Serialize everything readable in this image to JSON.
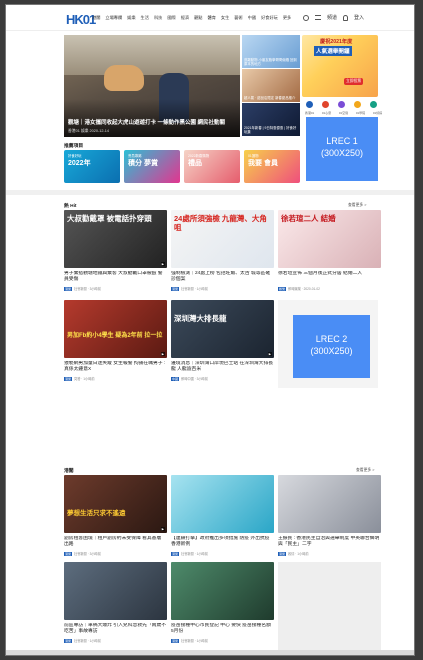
{
  "header": {
    "logo": "HK01",
    "nav": [
      "港聞",
      "立場專欄",
      "娛樂",
      "生活",
      "科技",
      "國際",
      "經濟",
      "觀點",
      "體育",
      "女生",
      "藝術",
      "中國",
      "好食好玩",
      "更多"
    ],
    "search_icon": "search-icon",
    "channels_label": "頻道",
    "login_label": "登入"
  },
  "hero": {
    "title": "觀塘｜港女攜同收起大虎山遊遊打卡 一條動作黑公園 網民社動關",
    "meta": "香港01 娛樂 2020-12-14"
  },
  "thumbs": [
    {
      "caption": "逃難動物 小朋友跑學哥哥偷蝦 回到原本的地方"
    },
    {
      "caption": "超人氣 · 甜品店限定 新春甜品推介"
    },
    {
      "caption": "2021年新春 | 9日特惠優惠 | 好食好玩集"
    }
  ],
  "promo": {
    "line1": "慶祝2021年度",
    "line2": "人氣選舉開鑼",
    "cta": "立即投票"
  },
  "app_labels": [
    "香港01",
    "01心意",
    "01空間",
    "01學院",
    "01偵探"
  ],
  "ads": {
    "lrec1": "LREC 1\n(300X250)",
    "lrec2": "LREC 2\n(300X250)"
  },
  "recommend": {
    "heading": "推薦項目",
    "banners": [
      {
        "sub": "好食好玩",
        "title": "2022年"
      },
      {
        "sub": "會員專屬",
        "title": "積分 夢賞"
      },
      {
        "sub": "2022新春購物",
        "title": "禮品"
      },
      {
        "sub": "01選物",
        "title": "我要 會員"
      }
    ]
  },
  "hot": {
    "heading": "熱 Hit",
    "more": "查看更多 >",
    "cards": [
      {
        "img_text": "大叔勸戴罩 被電話扑穿頭",
        "title": "男子乘搭觀塘地鐵與乘客 大叔勸戴口罩被毆 警員受傷",
        "tag": "港聞",
        "meta": "社會新聞 · 3小時前"
      },
      {
        "img_text": "24處所須強檢 九龍灣、大角咀",
        "title": "強制檢測｜24處上榜 包括旺角、太古 城等區確診個案",
        "tag": "港聞",
        "meta": "社會新聞 · 1小時前"
      },
      {
        "img_text": "徐若瑄二人 結婚",
        "title": "徐若瑄宣佈 三個月後正式分居 結婚二人",
        "tag": "娛樂",
        "meta": "即時娛樂 · 2020-01-02"
      },
      {
        "img_text": "男加Fb約小4學生 疑為2年前 拉一拉",
        "title": "猥褻網男加童日迷失蹤 女生報警 拘捕在職男子 : 真係太鍾意X",
        "tag": "港聞",
        "meta": "突發 · 1小時前"
      },
      {
        "img_text": "深圳灣大排長龍",
        "title": "邊境消息｜深圳灣口岸現巴士站 在深圳灣大排長龍 人龍逾百米",
        "tag": "中國",
        "meta": "即時中國 · 3小時前"
      }
    ]
  },
  "latest": {
    "heading": "港聞",
    "more": "查看更多 >",
    "cards": [
      {
        "img_text": "夢想生活只求不遙遠",
        "title": "劏房租客困境｜租戶劏房約未受保障 看其基層 出路",
        "tag": "港聞",
        "meta": "社會新聞 · 3小時前"
      },
      {
        "img_text": "",
        "title": "【連鎖打擊】政府推出多項措施 防疫 外出抗疫 香港新例",
        "tag": "港聞",
        "meta": "社會新聞 · 1小時前"
      },
      {
        "img_text": "",
        "title": "王振民 : 香港民主自治與選舉制度 中英聯合聲明與「民主」二字",
        "tag": "港聞",
        "meta": "政情 · 1小時前"
      },
      {
        "img_text": "",
        "title": "前區專訪｜車禍大爆炸 引入兒科急救先「兩歲不吃苦」事故專訪",
        "tag": "港聞",
        "meta": "社會新聞 · 1小時前"
      },
      {
        "img_text": "",
        "title": "疫苗接種中心市民登記 中心 要快 疫苗接種名額 5月份",
        "tag": "港聞",
        "meta": "社會新聞 · 1小時前"
      }
    ]
  }
}
